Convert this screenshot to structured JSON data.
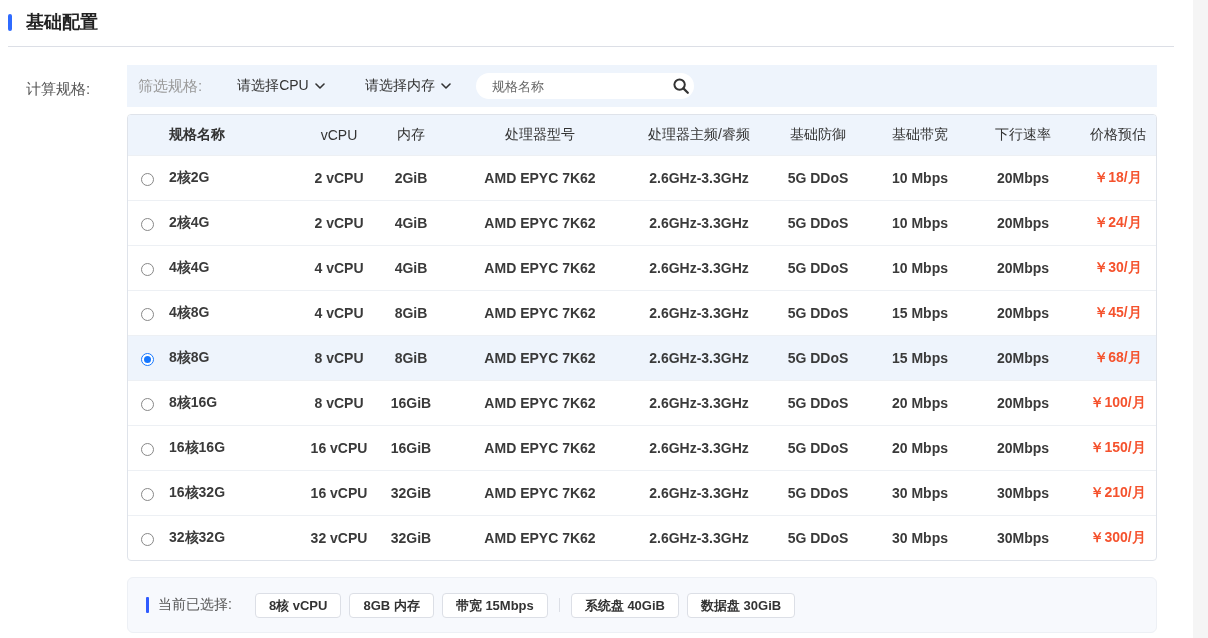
{
  "section": {
    "title": "基础配置"
  },
  "compute_spec": {
    "label": "计算规格:",
    "filter": {
      "label": "筛选规格:",
      "dropdowns": [
        {
          "placeholder": "请选择CPU"
        },
        {
          "placeholder": "请选择内存"
        }
      ],
      "search": {
        "placeholder": "规格名称"
      }
    },
    "table": {
      "columns": [
        "规格名称",
        "vCPU",
        "内存",
        "处理器型号",
        "处理器主频/睿频",
        "基础防御",
        "基础带宽",
        "下行速率",
        "价格预估"
      ],
      "rows": [
        {
          "selected": false,
          "cells": [
            "2核2G",
            "2 vCPU",
            "2GiB",
            "AMD EPYC 7K62",
            "2.6GHz-3.3GHz",
            "5G DDoS",
            "10 Mbps",
            "20Mbps",
            "￥18/月"
          ]
        },
        {
          "selected": false,
          "cells": [
            "2核4G",
            "2 vCPU",
            "4GiB",
            "AMD EPYC 7K62",
            "2.6GHz-3.3GHz",
            "5G DDoS",
            "10 Mbps",
            "20Mbps",
            "￥24/月"
          ]
        },
        {
          "selected": false,
          "cells": [
            "4核4G",
            "4 vCPU",
            "4GiB",
            "AMD EPYC 7K62",
            "2.6GHz-3.3GHz",
            "5G DDoS",
            "10 Mbps",
            "20Mbps",
            "￥30/月"
          ]
        },
        {
          "selected": false,
          "cells": [
            "4核8G",
            "4 vCPU",
            "8GiB",
            "AMD EPYC 7K62",
            "2.6GHz-3.3GHz",
            "5G DDoS",
            "15 Mbps",
            "20Mbps",
            "￥45/月"
          ]
        },
        {
          "selected": true,
          "cells": [
            "8核8G",
            "8 vCPU",
            "8GiB",
            "AMD EPYC 7K62",
            "2.6GHz-3.3GHz",
            "5G DDoS",
            "15 Mbps",
            "20Mbps",
            "￥68/月"
          ]
        },
        {
          "selected": false,
          "cells": [
            "8核16G",
            "8 vCPU",
            "16GiB",
            "AMD EPYC 7K62",
            "2.6GHz-3.3GHz",
            "5G DDoS",
            "20 Mbps",
            "20Mbps",
            "￥100/月"
          ]
        },
        {
          "selected": false,
          "cells": [
            "16核16G",
            "16 vCPU",
            "16GiB",
            "AMD EPYC 7K62",
            "2.6GHz-3.3GHz",
            "5G DDoS",
            "20 Mbps",
            "20Mbps",
            "￥150/月"
          ]
        },
        {
          "selected": false,
          "cells": [
            "16核32G",
            "16 vCPU",
            "32GiB",
            "AMD EPYC 7K62",
            "2.6GHz-3.3GHz",
            "5G DDoS",
            "30 Mbps",
            "30Mbps",
            "￥210/月"
          ]
        },
        {
          "selected": false,
          "cells": [
            "32核32G",
            "32 vCPU",
            "32GiB",
            "AMD EPYC 7K62",
            "2.6GHz-3.3GHz",
            "5G DDoS",
            "30 Mbps",
            "30Mbps",
            "￥300/月"
          ]
        }
      ]
    }
  },
  "summary": {
    "label": "当前已选择:",
    "chip_groups": [
      [
        "8核 vCPU",
        "8GB 内存",
        "带宽 15Mbps"
      ],
      [
        "系统盘 40GiB",
        "数据盘 30GiB"
      ]
    ]
  }
}
